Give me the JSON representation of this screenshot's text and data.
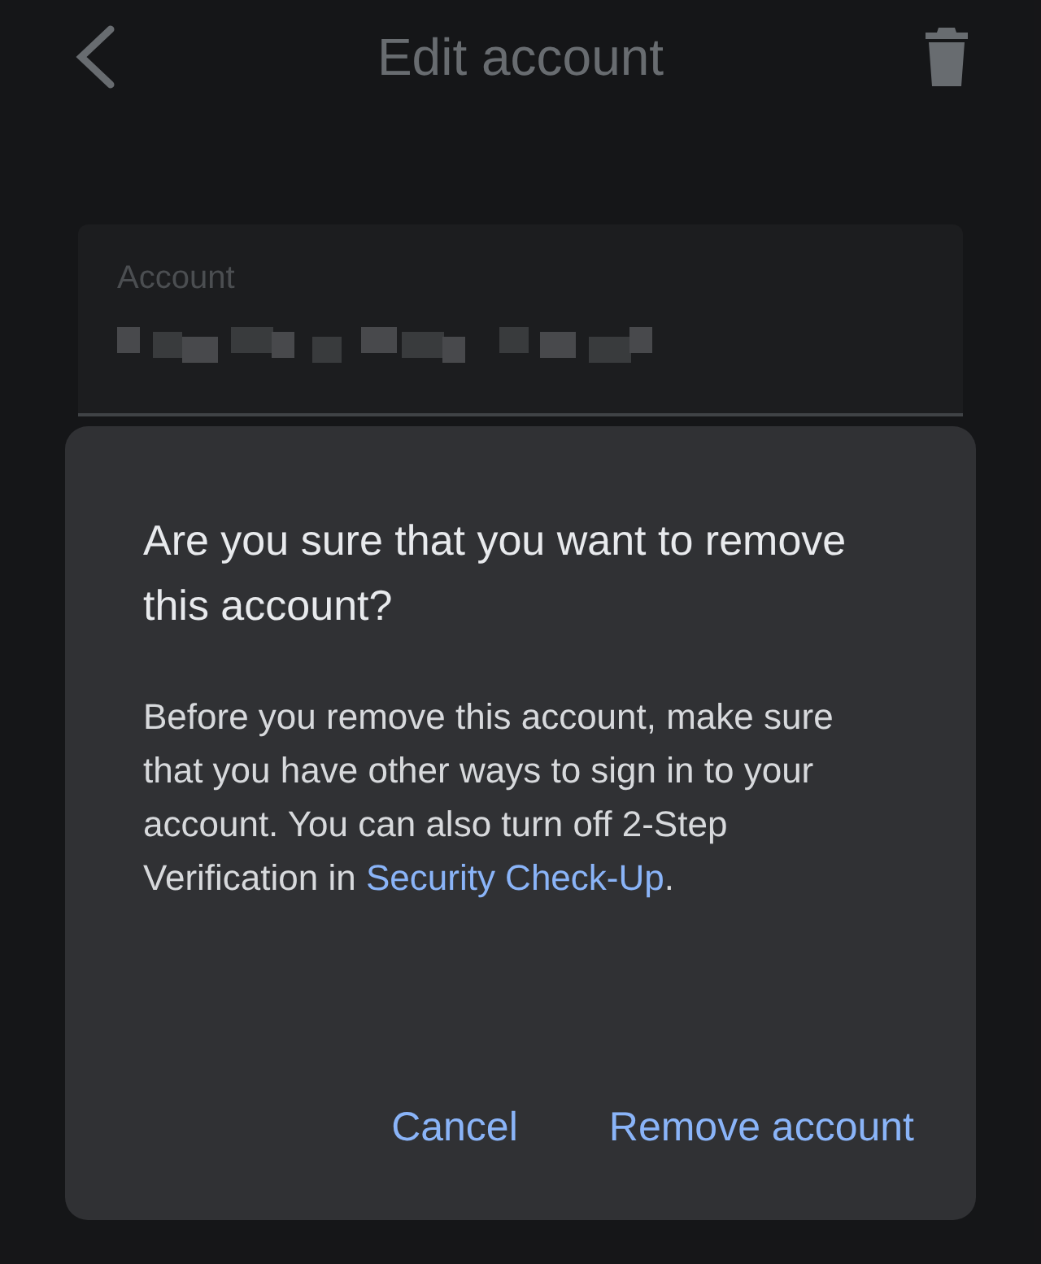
{
  "header": {
    "title": "Edit account"
  },
  "account_field": {
    "label": "Account"
  },
  "dialog": {
    "title": "Are you sure that you want to remove this account?",
    "body": {
      "text": "Before you remove this account, make sure that you have other ways to sign in to your account. You can also turn off 2-Step Verification in ",
      "link": "Security Check-Up",
      "after": "."
    },
    "buttons": [
      "Cancel",
      "Remove account"
    ]
  }
}
